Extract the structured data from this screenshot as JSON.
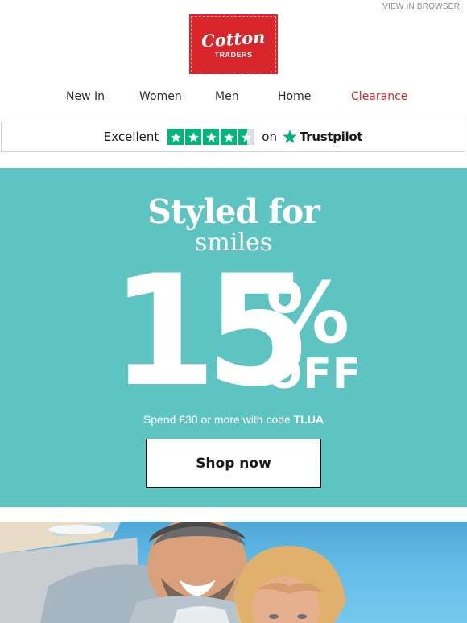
{
  "header": {
    "view_in_browser": "VIEW IN BROWSER"
  },
  "logo": {
    "word": "Cotton",
    "sub": "TRADERS"
  },
  "nav": [
    {
      "label": "New In"
    },
    {
      "label": "Women"
    },
    {
      "label": "Men"
    },
    {
      "label": "Home"
    },
    {
      "label": "Clearance",
      "color": "#d9262b"
    }
  ],
  "trustpilot": {
    "rating_label": "Excellent",
    "stars": 4.5,
    "on": "on",
    "brand": "Trustpilot",
    "star_color": "#00b67a"
  },
  "hero": {
    "background": "#5ec4c2",
    "title": "Styled for",
    "subtitle": "smiles",
    "percent": "15",
    "percent_sign": "%",
    "off": "OFF",
    "terms_prefix": "Spend £30 or more with code ",
    "code": "TLUA",
    "button_label": "Shop now"
  }
}
